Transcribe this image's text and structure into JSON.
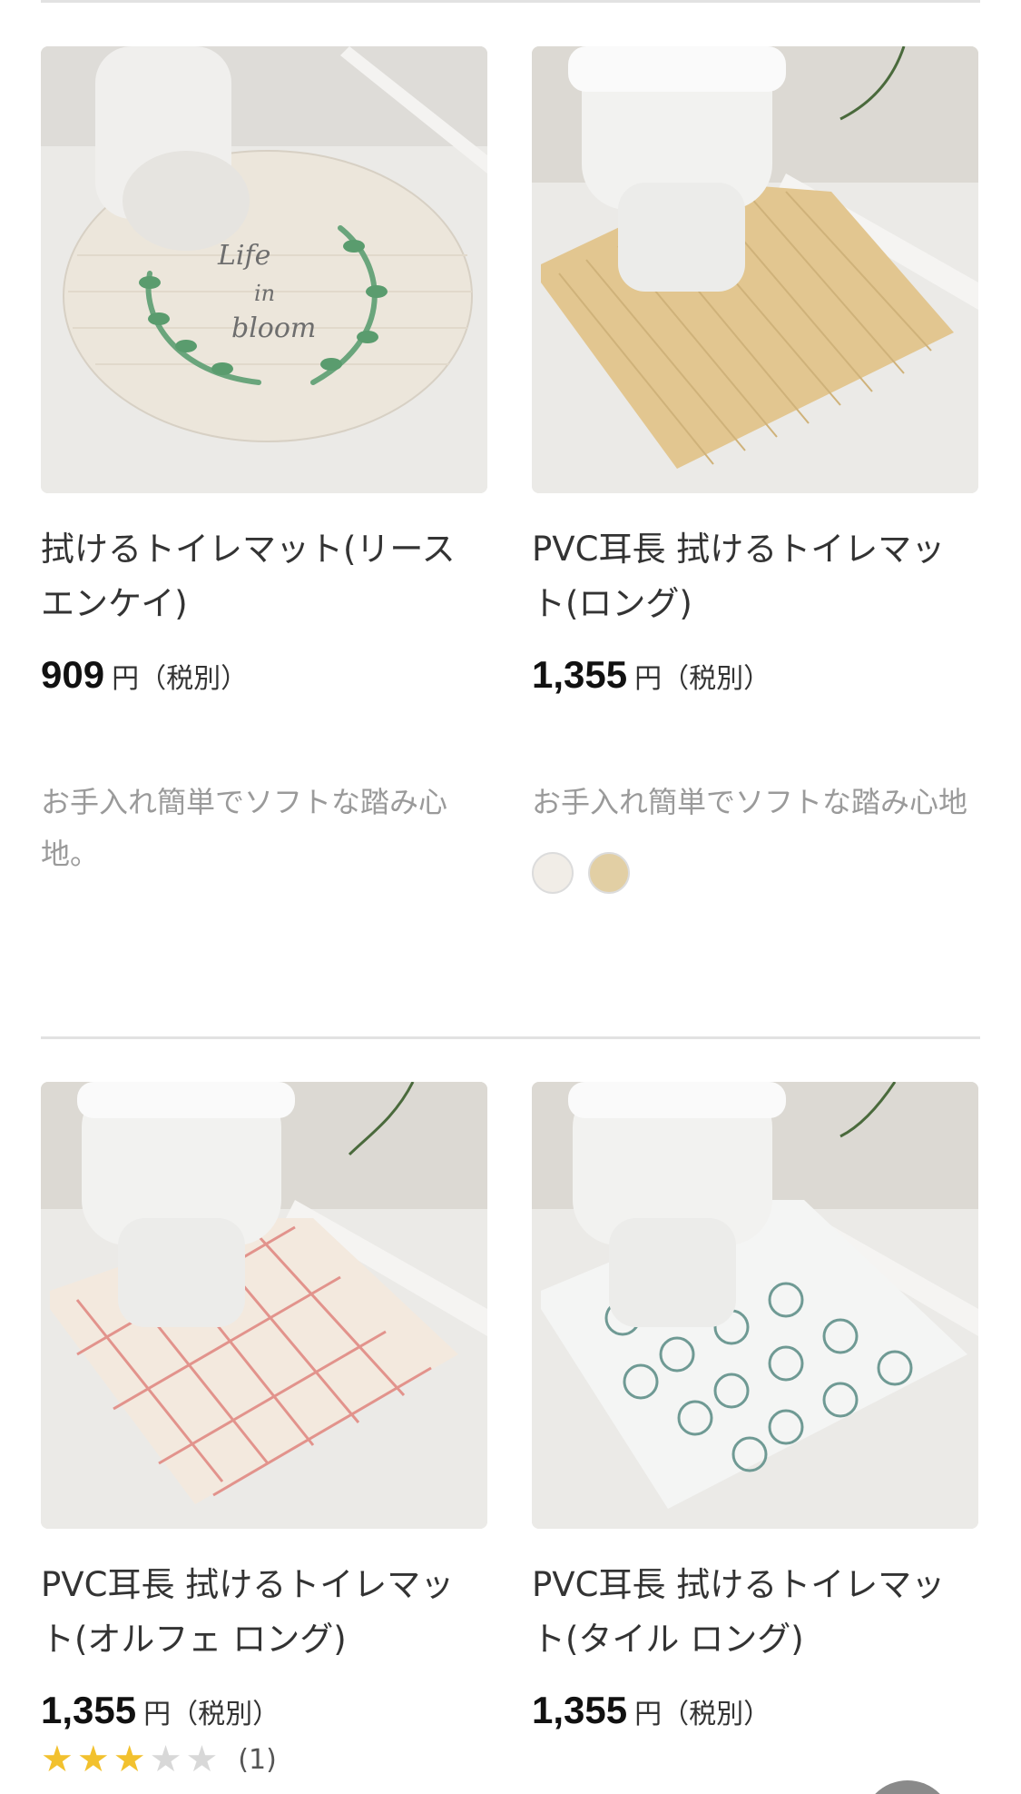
{
  "products": [
    {
      "title": "拭けるトイレマット(リースエンケイ)",
      "price": "909",
      "unit": "円",
      "tax": "（税別）",
      "description": "お手入れ簡単でソフトな踏み心地。",
      "image_text": [
        "Life",
        "in",
        "bloom"
      ]
    },
    {
      "title": "PVC耳長 拭けるトイレマット(ロング)",
      "price": "1,355",
      "unit": "円",
      "tax": "（税別）",
      "description": "お手入れ簡単でソフトな踏み心地",
      "swatches": [
        "#f1ede7",
        "#e2cfa4"
      ]
    },
    {
      "title": "PVC耳長 拭けるトイレマット(オルフェ ロング)",
      "price": "1,355",
      "unit": "円",
      "tax": "（税別）",
      "rating": {
        "stars": 3,
        "max": 5,
        "count": "(1)"
      }
    },
    {
      "title": "PVC耳長 拭けるトイレマット(タイル ロング)",
      "price": "1,355",
      "unit": "円",
      "tax": "（税別）"
    }
  ],
  "colors": {
    "star": "#f2c12e",
    "star_off": "#d8d8d8",
    "divider": "#e2e2e2",
    "desc": "#9a9a9a"
  }
}
